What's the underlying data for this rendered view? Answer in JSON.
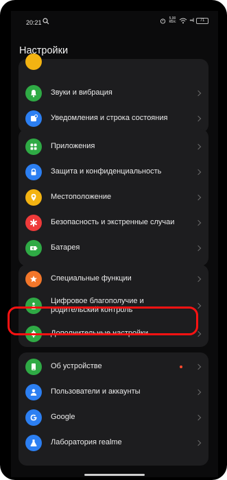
{
  "status_bar": {
    "time": "20:21",
    "speed_value": "5,00",
    "speed_unit": "КБ/с",
    "signal": "•••ll",
    "battery": "71"
  },
  "page_title": "Настройки",
  "groups": [
    {
      "items": [
        {
          "label": "Звуки и вибрация",
          "icon": "bell-icon",
          "color": "#2faa45"
        },
        {
          "label": "Уведомления и строка состояния",
          "icon": "notification-icon",
          "color": "#2c7ff2"
        }
      ]
    },
    {
      "items": [
        {
          "label": "Приложения",
          "icon": "apps-grid-icon",
          "color": "#2faa45"
        },
        {
          "label": "Защита и конфиденциальность",
          "icon": "lock-icon",
          "color": "#2c7ff2"
        },
        {
          "label": "Местоположение",
          "icon": "location-pin-icon",
          "color": "#f3b312"
        },
        {
          "label": "Безопасность и экстренные случаи",
          "icon": "emergency-asterisk-icon",
          "color": "#ee3a3a"
        },
        {
          "label": "Батарея",
          "icon": "battery-icon",
          "color": "#2faa45"
        }
      ]
    },
    {
      "items": [
        {
          "label": "Специальные функции",
          "icon": "star-icon",
          "color": "#f2762a"
        },
        {
          "label": "Цифровое благополучие и\nродительский контроль",
          "icon": "wellbeing-icon",
          "color": "#2faa45"
        },
        {
          "label": "Дополнительные настройки",
          "icon": "gear-icon",
          "color": "#2faa45"
        }
      ]
    },
    {
      "items": [
        {
          "label": "Об устройстве",
          "icon": "phone-icon",
          "color": "#2faa45"
        },
        {
          "label": "Пользователи и аккаунты",
          "icon": "user-icon",
          "color": "#2c7ff2"
        },
        {
          "label": "Google",
          "icon": "google-icon",
          "color": "#2c7ff2"
        },
        {
          "label": "Лаборатория realme",
          "icon": "flask-icon",
          "color": "#2c7ff2"
        }
      ]
    }
  ]
}
